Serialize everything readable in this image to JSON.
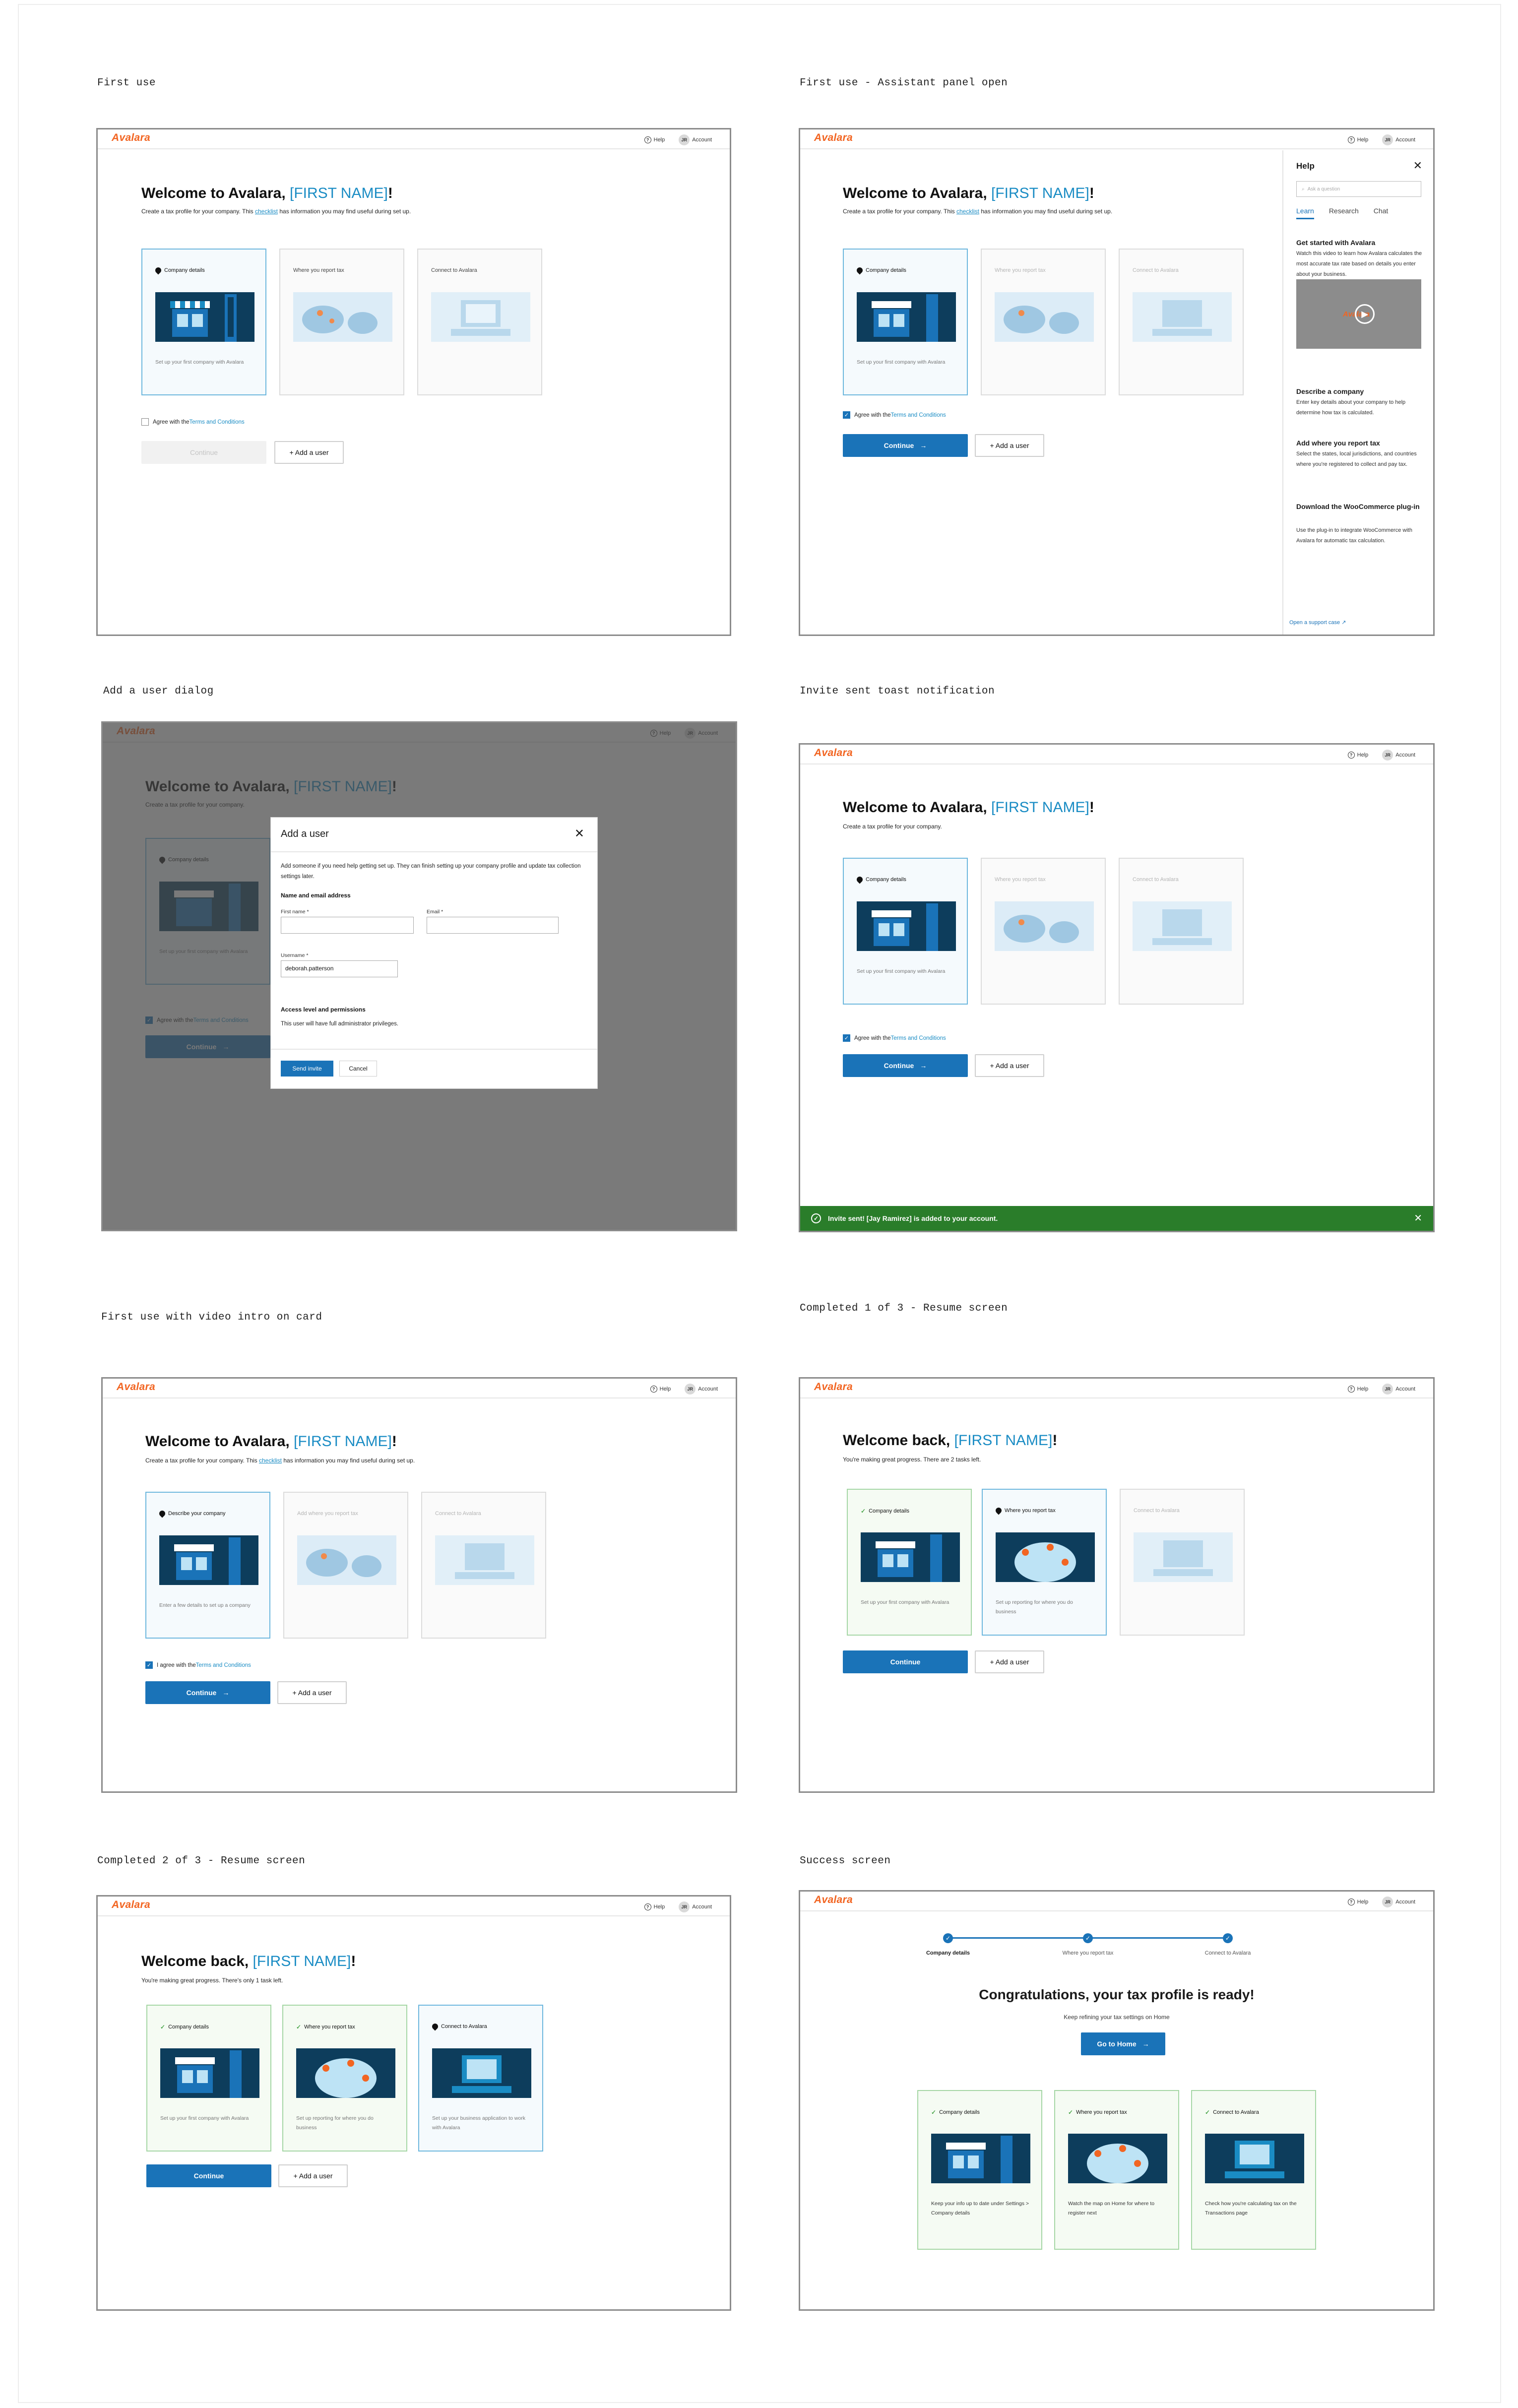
{
  "captions": {
    "s1": "First use",
    "s2": "First use - Assistant panel open",
    "s3": "Add a user dialog",
    "s4": "Invite sent toast notification",
    "s5": "First use with video intro on card",
    "s6": "Completed 1 of 3 - Resume screen",
    "s7": "Completed 2 of 3 - Resume screen",
    "s8": "Success screen"
  },
  "nav": {
    "logo": "Avalara",
    "help": "Help",
    "initials": "JR",
    "account": "Account"
  },
  "text": {
    "welcome": "Welcome to Avalara, ",
    "welcome_back": "Welcome back, ",
    "first_name": "[FIRST NAME]",
    "bang": "!",
    "sub_a": "Create a tax profile for your company. This ",
    "sub_link": "checklist",
    "sub_b": " has information you may find useful during set up.",
    "sub_short": "Create a tax profile for your company.",
    "sub_progress2": "You're making great progress. There are 2 tasks left.",
    "sub_progress1": "You're making great progress. There's only 1 task left.",
    "agree_pre": "Agree with the ",
    "agree_pre_i": "I agree with the ",
    "terms": "Terms and Conditions",
    "continue": "Continue",
    "arrow": "→",
    "add_user": "+ Add a user"
  },
  "cards": {
    "company": "Company details",
    "describe": "Describe your company",
    "report": "Where you report tax",
    "add_report": "Add where you report tax",
    "connect": "Connect to Avalara",
    "company_desc": "Set up your first company with Avalara",
    "describe_desc": "Enter a few details to set up a company",
    "report_desc": "Set up reporting for where you do business",
    "connect_desc": "Set up your business application to work with Avalara",
    "s_company_desc": "Keep your info up to date under Settings > Company details",
    "s_report_desc": "Watch the map on Home for where to register next",
    "s_connect_desc": "Check how you're calculating tax on the Transactions page"
  },
  "help_panel": {
    "title": "Help",
    "close": "✕",
    "search_placeholder": "Ask a question",
    "tabs": [
      "Learn",
      "Research",
      "Chat"
    ],
    "h1": "Get started with Avalara",
    "p1": "Watch this video to learn how Avalara calculates the most accurate tax rate based on details you enter about your business.",
    "video_logo": "Avalara",
    "h2": "Describe a company",
    "p2": "Enter key details about your company to help determine how tax is calculated.",
    "h3": "Add where you report tax",
    "p3": "Select the states, local jurisdictions, and countries where you're registered to collect and pay tax.",
    "h4": "Download the WooCommerce plug-in",
    "p4": "Use the plug-in to integrate WooCommerce with Avalara for automatic tax calculation.",
    "support": "Open a support case"
  },
  "dialog": {
    "title": "Add a user",
    "close": "✕",
    "intro": "Add someone if you need help getting set up. They can finish setting up your company profile and update tax collection settings later.",
    "sec1": "Name and email address",
    "first_label": "First name *",
    "email_label": "Email *",
    "username_label": "Username *",
    "username_value": "deborah.patterson",
    "sec2": "Access level and permissions",
    "perm": "This user will have full administrator privileges.",
    "send": "Send invite",
    "cancel": "Cancel"
  },
  "toast": {
    "message": "Invite sent! [Jay Ramirez] is added to your account.",
    "close": "✕"
  },
  "success": {
    "steps": [
      "Company details",
      "Where you report tax",
      "Connect to Avalara"
    ],
    "title": "Congratulations, your tax profile is ready!",
    "sub": "Keep refining your tax settings on Home",
    "button": "Go to Home"
  },
  "colors": {
    "brand": "#f26522",
    "accent": "#1a73b8",
    "success": "#2a7d2a",
    "link": "#1a8cc4"
  }
}
